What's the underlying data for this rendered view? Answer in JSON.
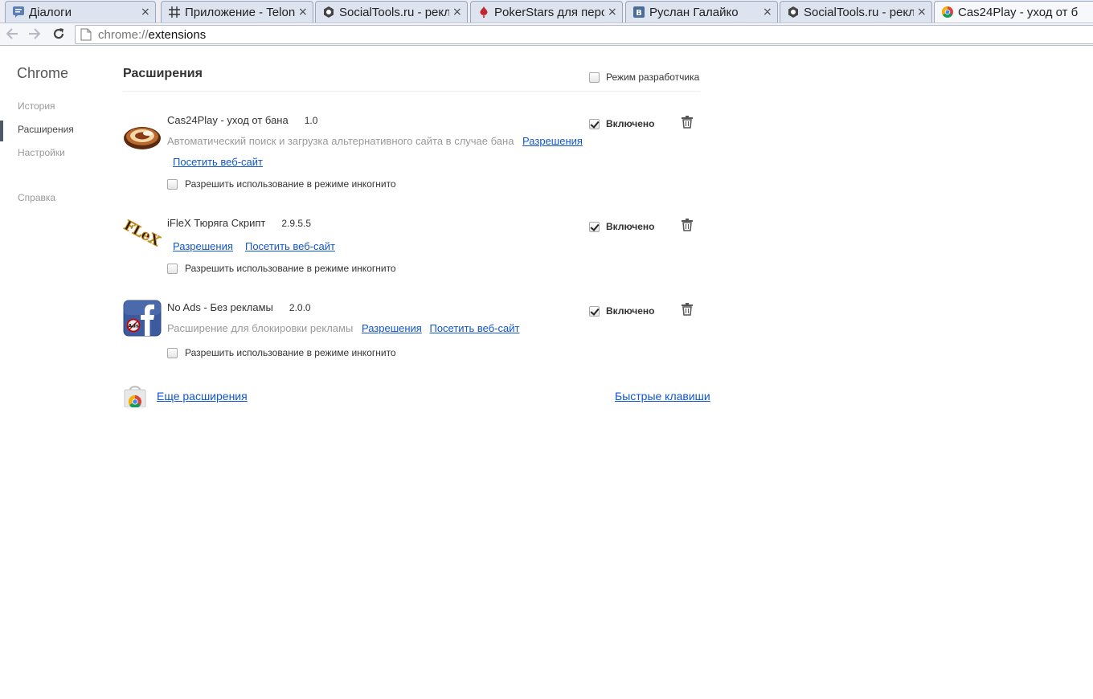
{
  "tabs": [
    {
      "title": "Діалоги",
      "favicon": "chat-bubble-icon",
      "active": false
    },
    {
      "title": "Приложение - Telon",
      "favicon": "hash-icon",
      "active": false
    },
    {
      "title": "SocialTools.ru - рекл",
      "favicon": "hexagon-icon",
      "active": false
    },
    {
      "title": "PokerStars для персо",
      "favicon": "pokerstars-icon",
      "active": false
    },
    {
      "title": "Руслан Галайко",
      "favicon": "vk-icon",
      "active": false
    },
    {
      "title": "SocialTools.ru - рекл",
      "favicon": "hexagon-icon",
      "active": false
    },
    {
      "title": "Cas24Play - уход от б",
      "favicon": "chrome-icon",
      "active": true
    }
  ],
  "address": {
    "scheme": "chrome://",
    "host": "extensions"
  },
  "sidebar": {
    "brand": "Chrome",
    "items": [
      {
        "label": "История"
      },
      {
        "label": "Расширения",
        "selected": true
      },
      {
        "label": "Настройки"
      },
      {
        "label": "Справка"
      }
    ]
  },
  "main": {
    "title": "Расширения",
    "dev_mode_label": "Режим разработчика",
    "extensions": [
      {
        "name": "Cas24Play - уход от бана",
        "version": "1.0",
        "description": "Автоматический поиск и загрузка альтернативного сайта в случае бана",
        "permissions_link": "Разрешения",
        "website_link": "Посетить веб-сайт",
        "incognito_label": "Разрешить использование в режиме инкогнито",
        "enabled_label": "Включено"
      },
      {
        "name": "iFleX Тюряга Скрипт",
        "version": "2.9.5.5",
        "description": "",
        "permissions_link": "Разрешения",
        "website_link": "Посетить веб-сайт",
        "incognito_label": "Разрешить использование в режиме инкогнито",
        "enabled_label": "Включено"
      },
      {
        "name": "No Ads - Без рекламы",
        "version": "2.0.0",
        "description": "Расширение для блокировки рекламы",
        "permissions_link": "Разрешения",
        "website_link": "Посетить веб-сайт",
        "incognito_label": "Разрешить использование в режиме инкогнито",
        "enabled_label": "Включено",
        "icon_badge_text": "Ads"
      }
    ],
    "more_extensions_link": "Еще расширения",
    "keyboard_shortcuts_link": "Быстрые клавиши"
  }
}
